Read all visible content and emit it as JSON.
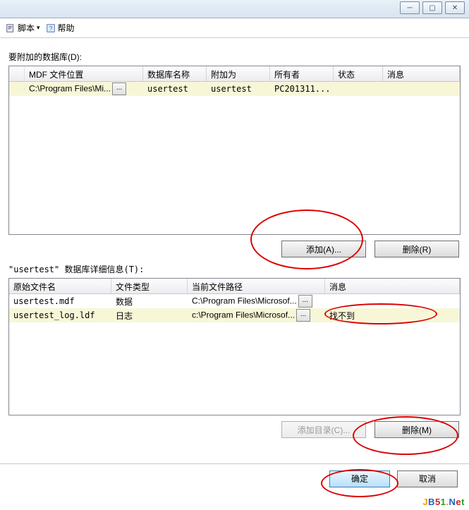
{
  "window": {
    "minimize": "─",
    "maximize": "▢",
    "close": "✕"
  },
  "toolbar": {
    "script": "脚本",
    "help": "帮助",
    "dropdown": "▾"
  },
  "section1_label": "要附加的数据库(D):",
  "grid1": {
    "headers": {
      "mdf": "MDF 文件位置",
      "dbname": "数据库名称",
      "attach": "附加为",
      "owner": "所有者",
      "state": "状态",
      "message": "消息"
    },
    "row": {
      "mdf": "C:\\Program Files\\Mi...",
      "dbname": "usertest",
      "attach": "usertest",
      "owner": "PC201311...",
      "state": "",
      "message": ""
    }
  },
  "buttons1": {
    "add": "添加(A)...",
    "remove": "删除(R)"
  },
  "section2_label": "\"usertest\" 数据库详细信息(T):",
  "grid2": {
    "headers": {
      "orig": "原始文件名",
      "type": "文件类型",
      "path": "当前文件路径",
      "message": "消息"
    },
    "rows": [
      {
        "orig": "usertest.mdf",
        "type": "数据",
        "path": "C:\\Program Files\\Microsof...",
        "message": ""
      },
      {
        "orig": "usertest_log.ldf",
        "type": "日志",
        "path": "c:\\Program Files\\Microsof...",
        "message": "找不到"
      }
    ]
  },
  "buttons2": {
    "adddir": "添加目录(C)...",
    "remove": "删除(M)"
  },
  "footer": {
    "ok": "确定",
    "cancel": "取消"
  },
  "ellipsis": "...",
  "watermark": {
    "j": "J",
    "b": "B",
    "5": "5",
    "1": "1",
    "dot": ".",
    "n": "N",
    "e": "e",
    "t": "t"
  }
}
